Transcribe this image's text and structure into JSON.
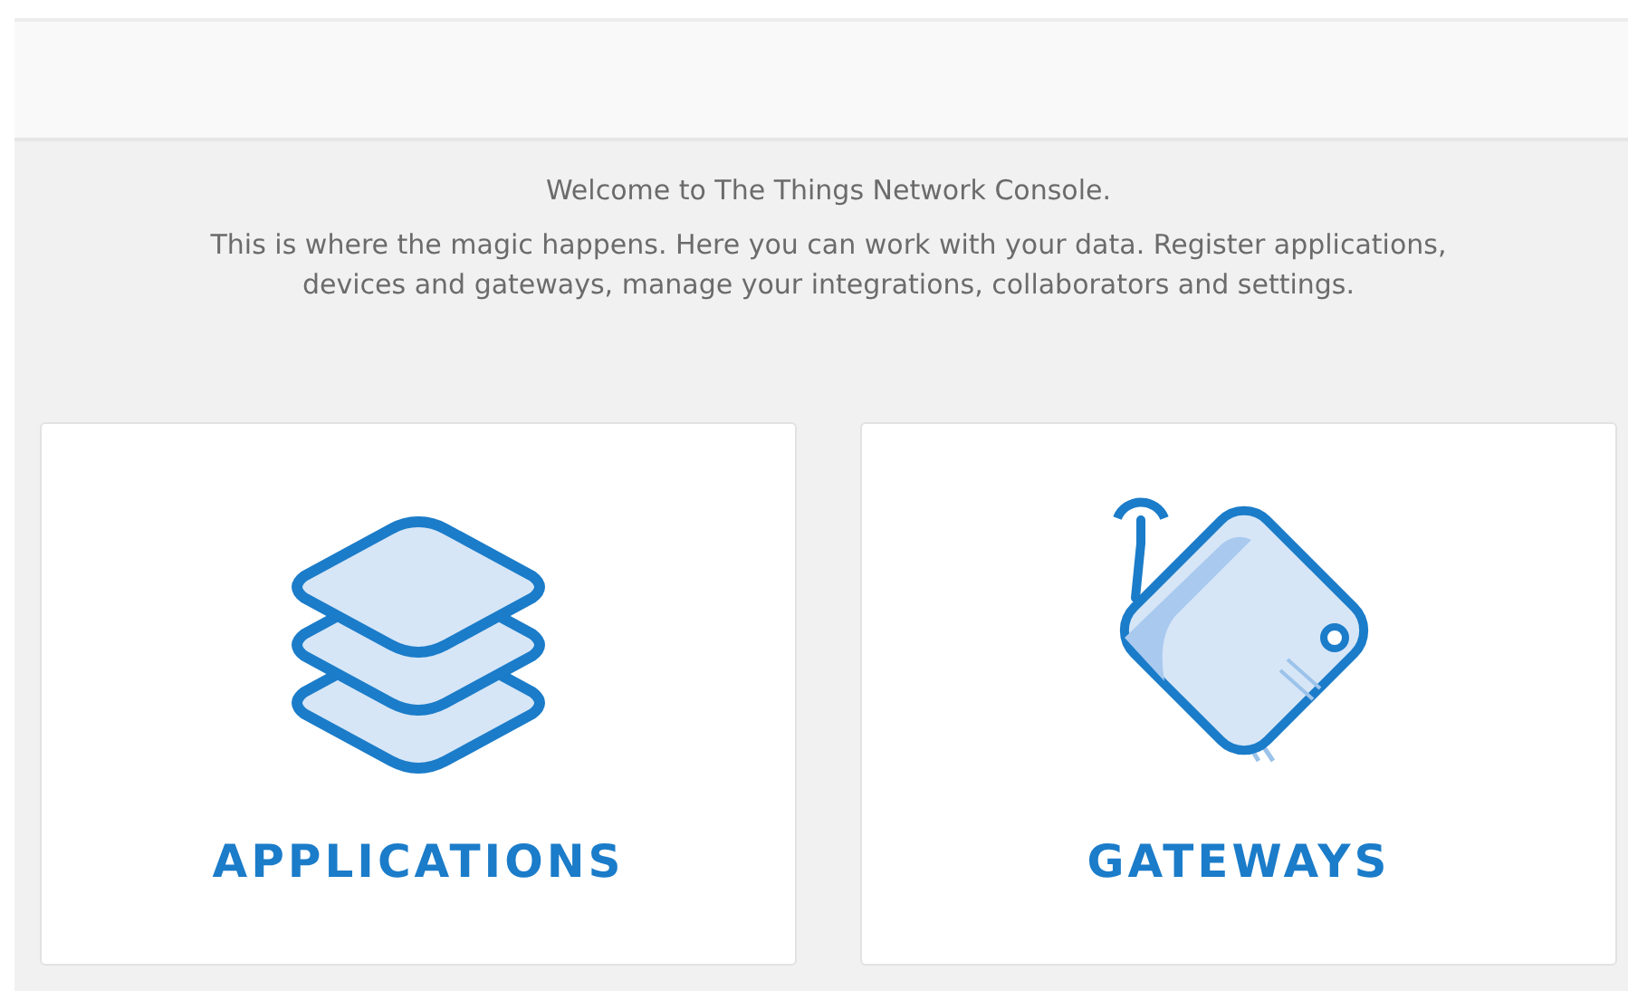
{
  "intro": {
    "title": "Welcome to The Things Network Console.",
    "text": "This is where the magic happens. Here you can work with your data. Register applications, devices and gateways, manage your integrations, collaborators and settings."
  },
  "cards": [
    {
      "kind": "applications",
      "label": "APPLICATIONS"
    },
    {
      "kind": "gateways",
      "label": "GATEWAYS"
    }
  ]
}
